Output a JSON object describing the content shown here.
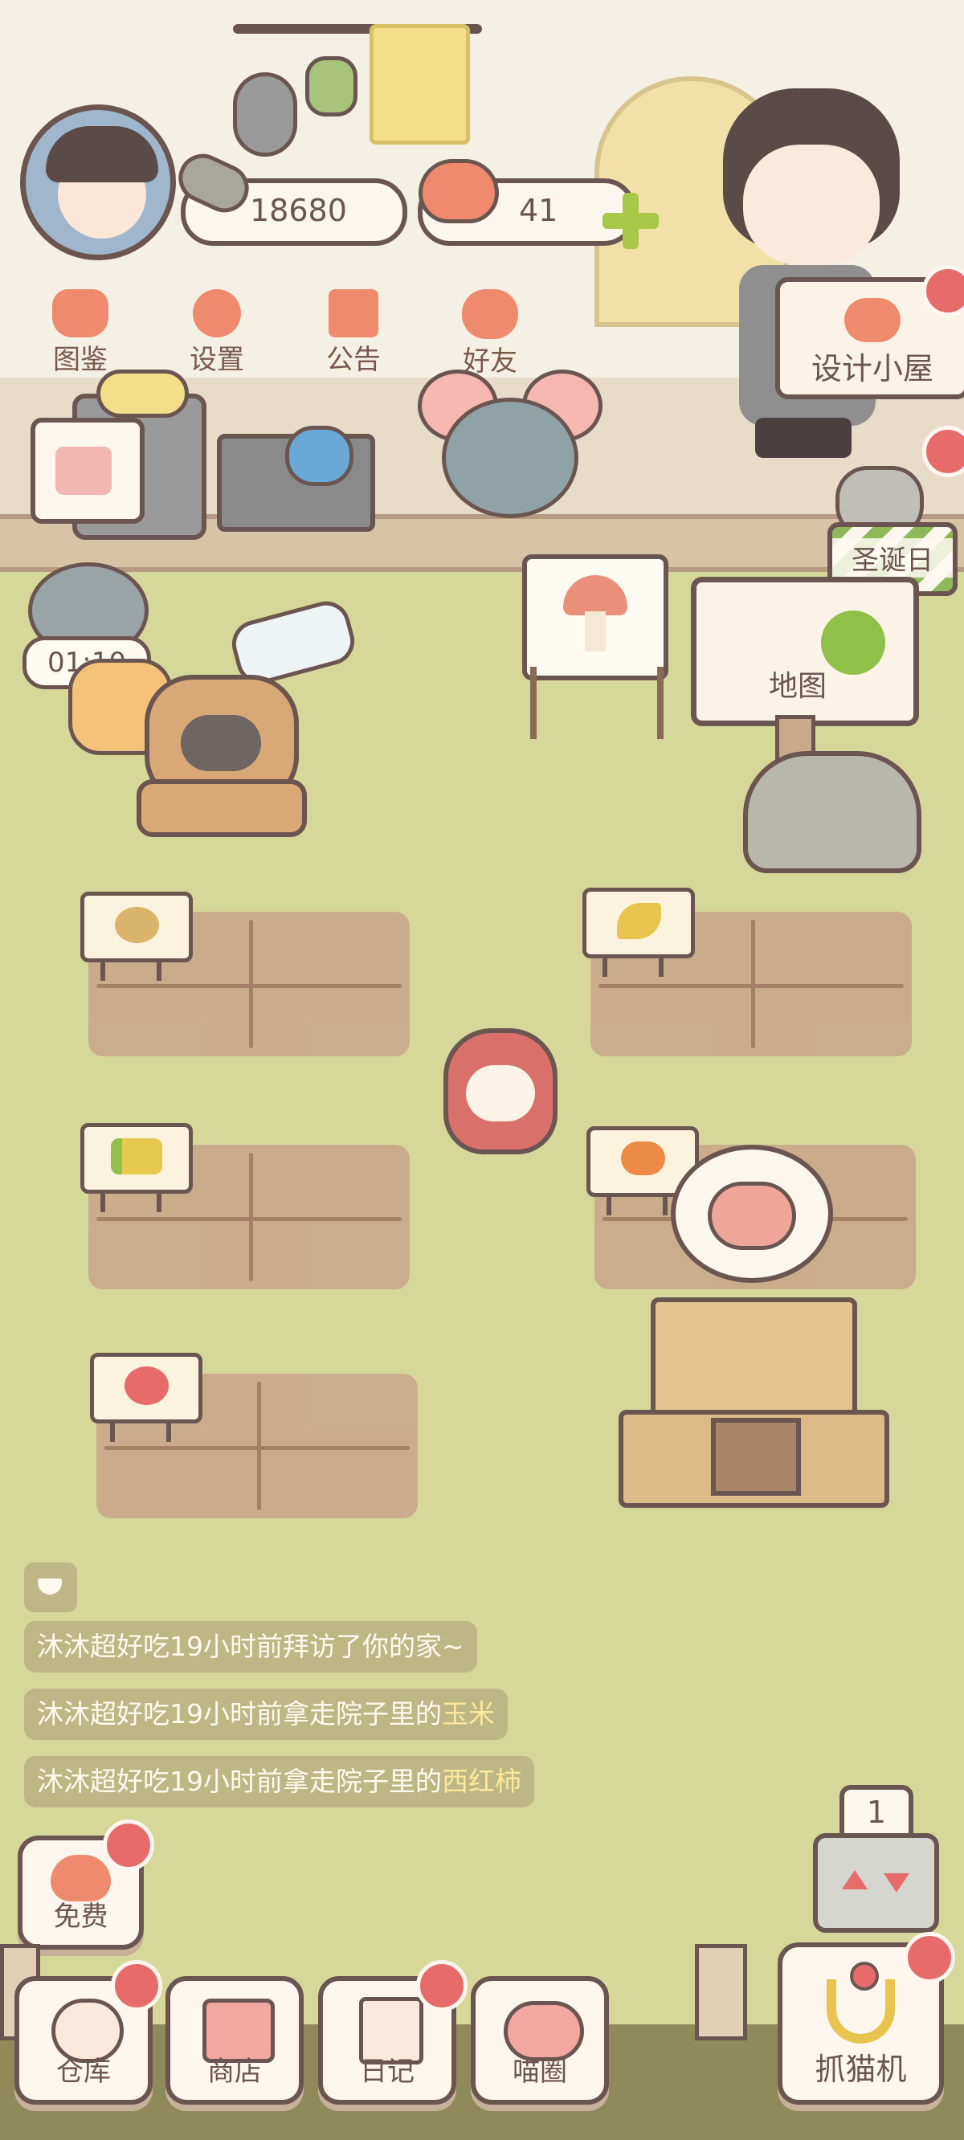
{
  "resources": {
    "fish_count": "18680",
    "heart_count": "41"
  },
  "top_menu": [
    {
      "label": "图鉴",
      "icon": "cat-book-icon"
    },
    {
      "label": "设置",
      "icon": "gear-icon"
    },
    {
      "label": "公告",
      "icon": "gift-icon"
    },
    {
      "label": "好友",
      "icon": "friends-icon"
    }
  ],
  "design_house_label": "设计小屋",
  "christmas_label": "圣诞日",
  "map_label": "地图",
  "timer": "01:10",
  "messages": [
    {
      "prefix": "沐沐超好吃19小时前拜访了你的家~",
      "item": ""
    },
    {
      "prefix": "沐沐超好吃19小时前拿走院子里的",
      "item": "玉米"
    },
    {
      "prefix": "沐沐超好吃19小时前拿走院子里的",
      "item": "西红柿"
    }
  ],
  "free_label": "免费",
  "bottom_nav": [
    {
      "label": "仓库",
      "icon": "warehouse-icon"
    },
    {
      "label": "商店",
      "icon": "shop-icon"
    },
    {
      "label": "日记",
      "icon": "diary-icon"
    },
    {
      "label": "喵圈",
      "icon": "cat-planet-icon"
    }
  ],
  "claw_machine_label": "抓猫机",
  "claw_machine_count": "1",
  "colors": {
    "grass": "#d6d89a",
    "wall": "#f3efe2",
    "outline": "#6b5550",
    "badge": "#e86b6b",
    "accent": "#f08a6e"
  }
}
